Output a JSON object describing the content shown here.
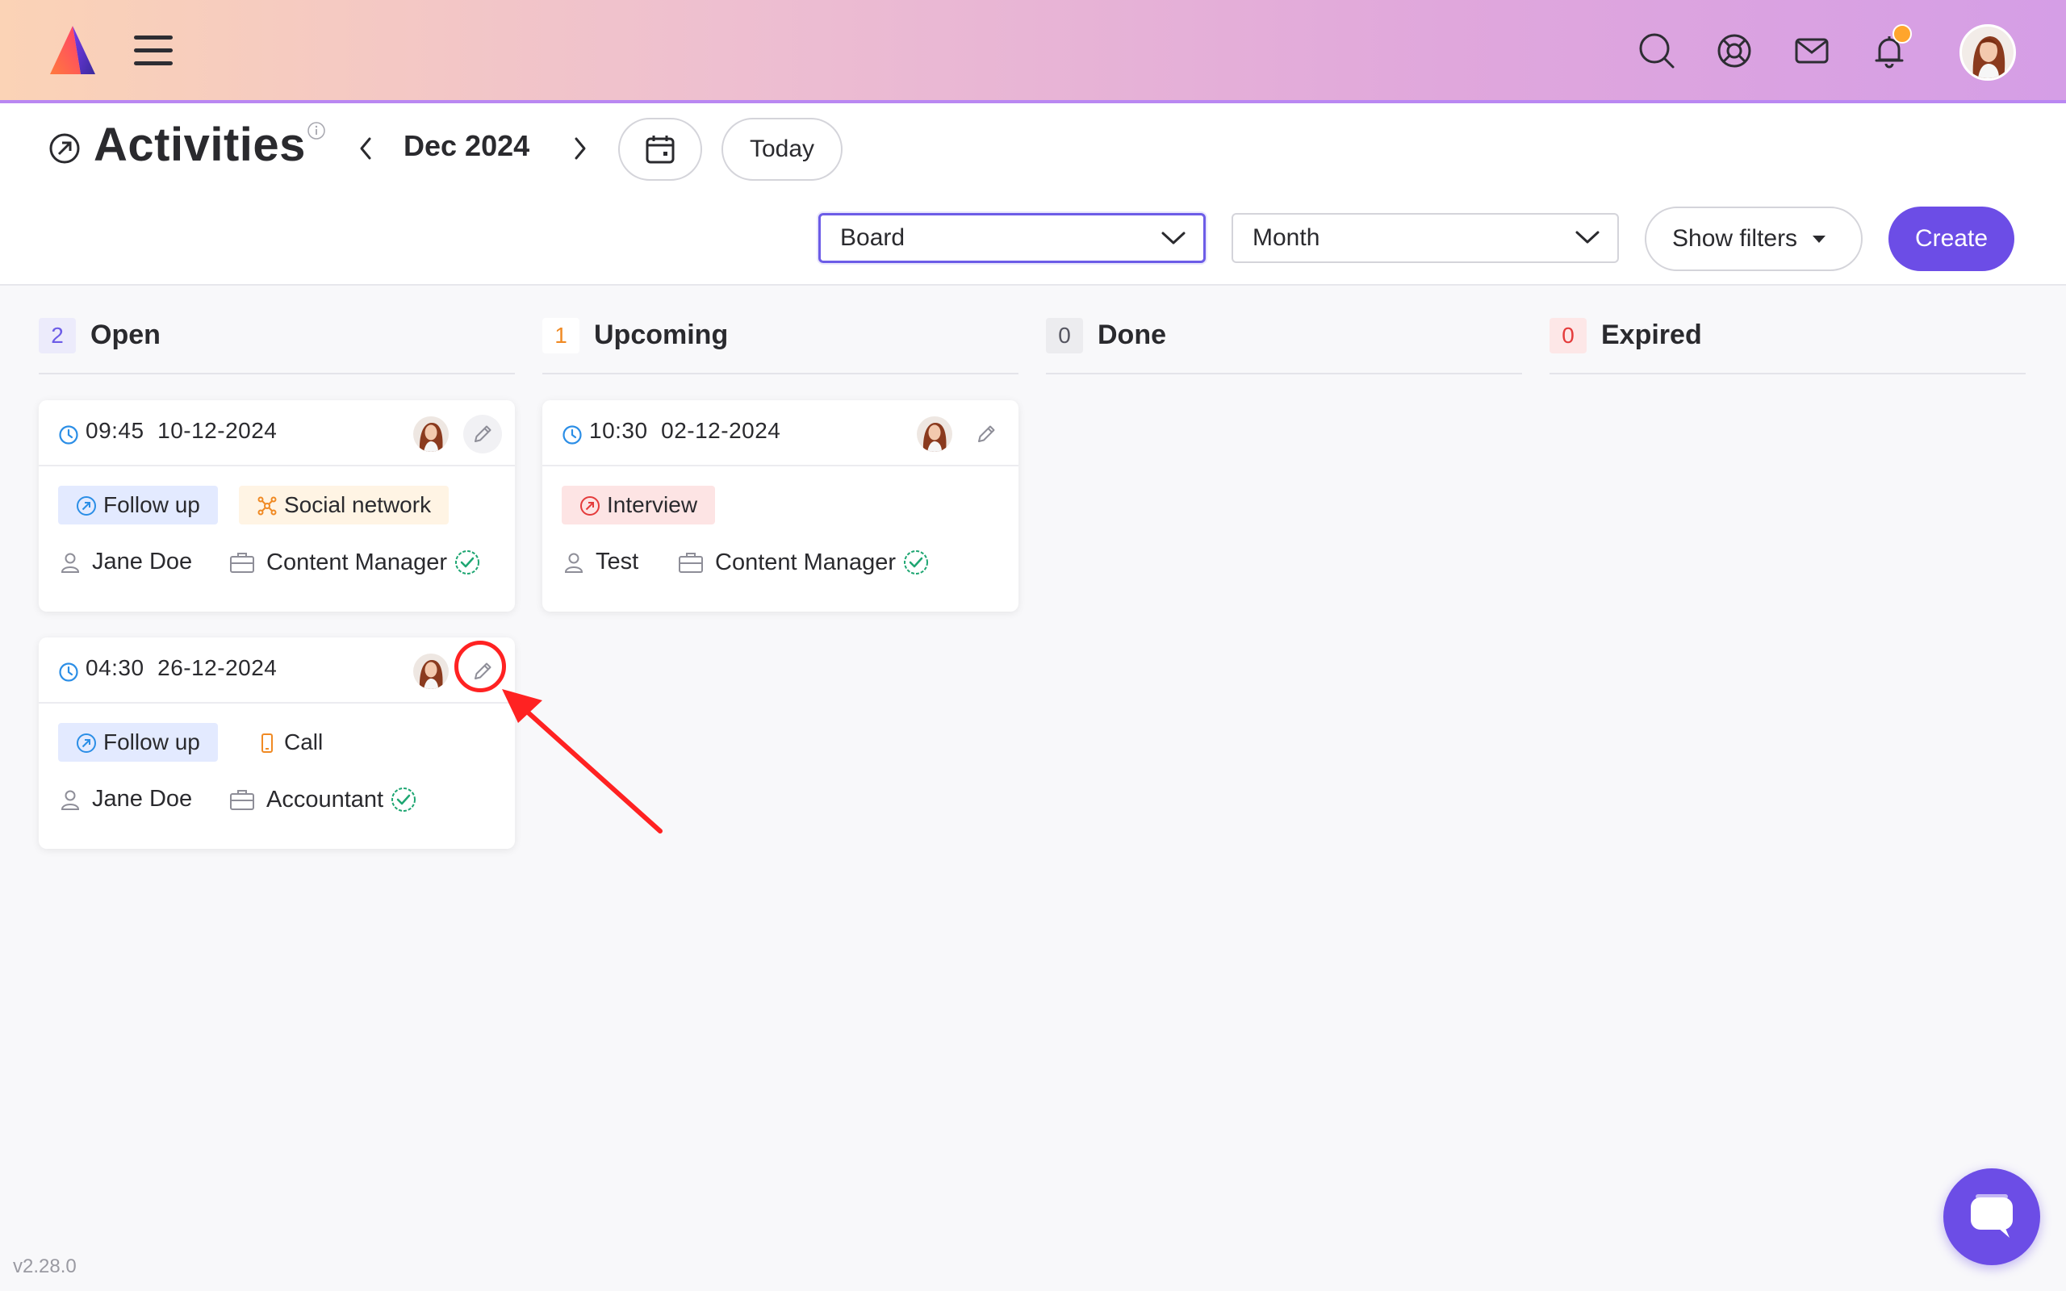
{
  "header": {
    "page_title": "Activities",
    "month": "Dec 2024",
    "today_label": "Today"
  },
  "toolbar": {
    "view_select": "Board",
    "period_select": "Month",
    "filters_label": "Show filters",
    "create_label": "Create"
  },
  "columns": [
    {
      "count": "2",
      "name": "Open",
      "accent": "#6c5ce7",
      "bg": "#ecebfb"
    },
    {
      "count": "1",
      "name": "Upcoming",
      "accent": "#f08a24",
      "bg": "#ffffff"
    },
    {
      "count": "0",
      "name": "Done",
      "accent": "#555560",
      "bg": "#ececef"
    },
    {
      "count": "0",
      "name": "Expired",
      "accent": "#e43b3b",
      "bg": "#fde7e7"
    }
  ],
  "cards": [
    {
      "time": "09:45",
      "date": "10-12-2024",
      "type_tag": "Follow up",
      "channel_tag": "Social network",
      "person": "Jane Doe",
      "position": "Content Manager"
    },
    {
      "time": "04:30",
      "date": "26-12-2024",
      "type_tag": "Follow up",
      "channel_tag": "Call",
      "person": "Jane Doe",
      "position": "Accountant"
    },
    {
      "time": "10:30",
      "date": "02-12-2024",
      "type_tag": "Interview",
      "person": "Test",
      "position": "Content Manager"
    }
  ],
  "footer": {
    "version": "v2.28.0"
  },
  "icons": {
    "top": [
      "search-icon",
      "support-icon",
      "mail-icon",
      "bell-icon"
    ],
    "notification_dot_color": "#ffa52c",
    "brand_color": "#6c4de6"
  }
}
